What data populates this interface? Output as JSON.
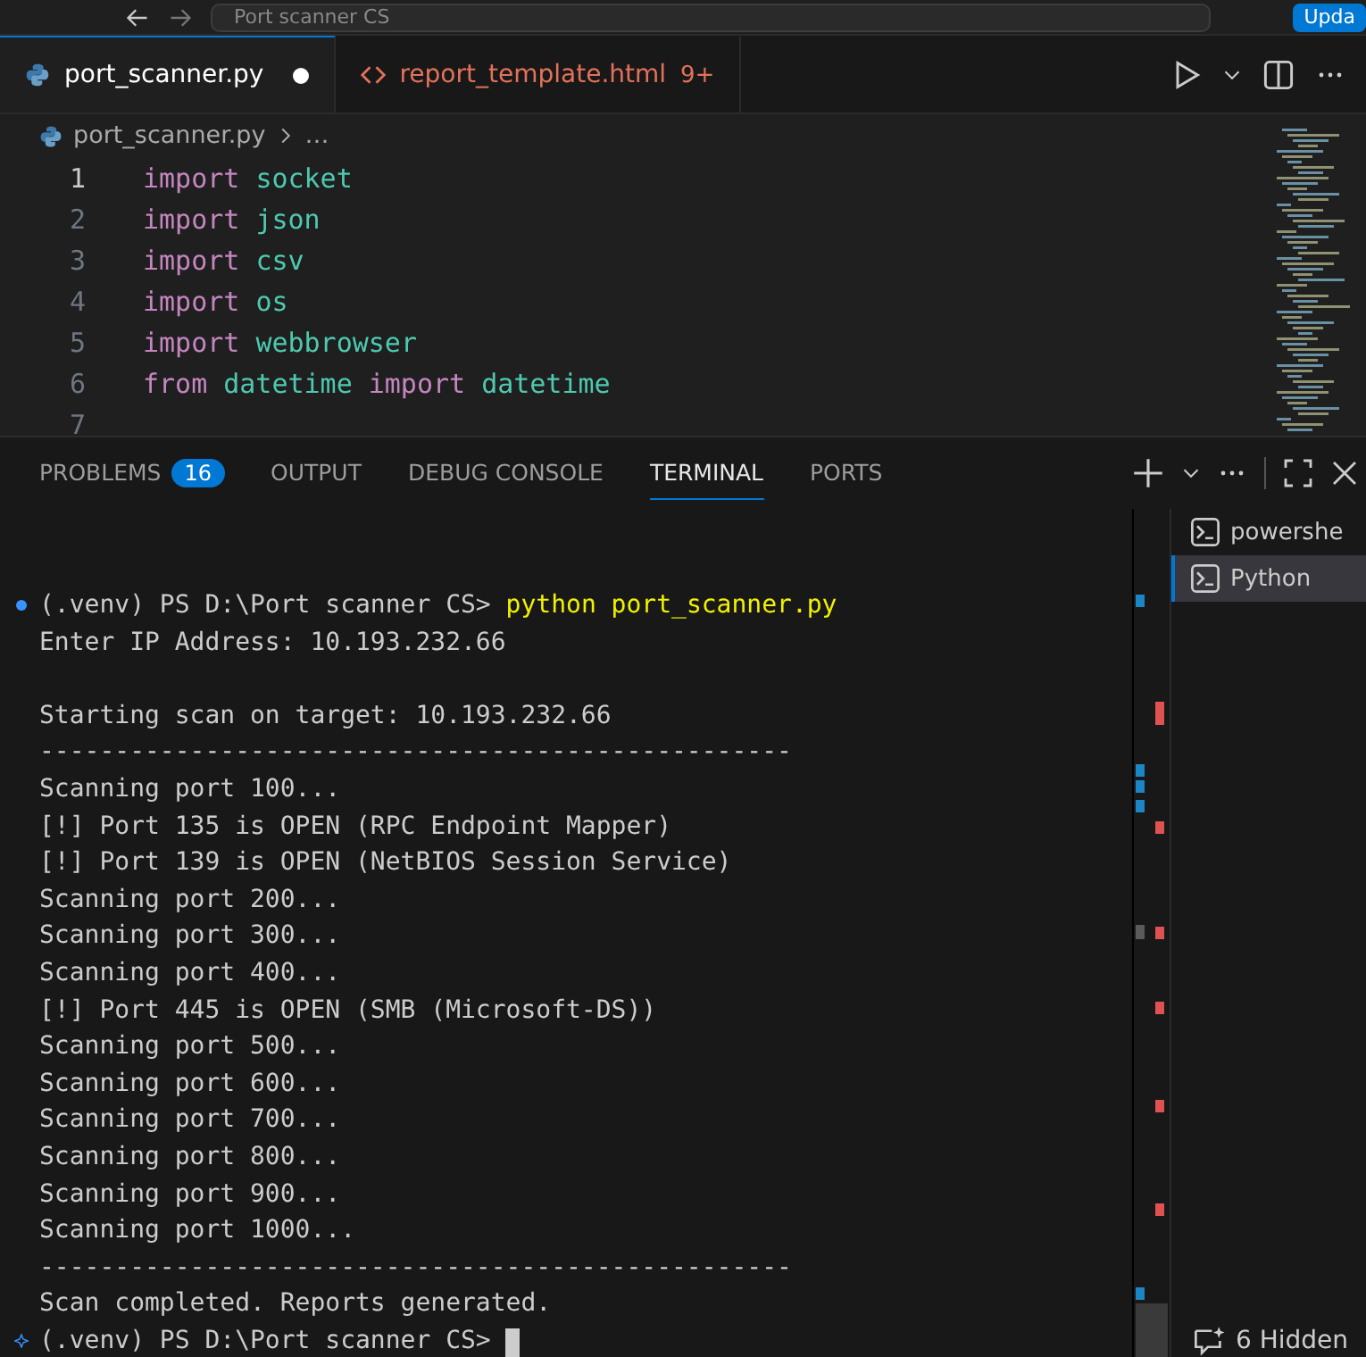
{
  "title_bar": {
    "search": "Port scanner CS",
    "update_button": "Upda"
  },
  "editor_tabs": [
    {
      "label": "port_scanner.py",
      "kind": "python",
      "selected": true,
      "modified": true
    },
    {
      "label": "report_template.html",
      "kind": "html",
      "selected": false,
      "modified": false,
      "problems": "9+"
    }
  ],
  "breadcrumb": {
    "file": "port_scanner.py",
    "more": "…"
  },
  "code_lines": [
    {
      "number": "1",
      "tokens": [
        {
          "text": "import",
          "kind": "keyword"
        },
        {
          "text": "socket",
          "kind": "module"
        }
      ]
    },
    {
      "number": "2",
      "tokens": [
        {
          "text": "import",
          "kind": "keyword"
        },
        {
          "text": "json",
          "kind": "module"
        }
      ]
    },
    {
      "number": "3",
      "tokens": [
        {
          "text": "import",
          "kind": "keyword"
        },
        {
          "text": "csv",
          "kind": "module"
        }
      ]
    },
    {
      "number": "4",
      "tokens": [
        {
          "text": "import",
          "kind": "keyword"
        },
        {
          "text": "os",
          "kind": "module"
        }
      ]
    },
    {
      "number": "5",
      "tokens": [
        {
          "text": "import",
          "kind": "keyword"
        },
        {
          "text": "webbrowser",
          "kind": "module"
        }
      ]
    },
    {
      "number": "6",
      "tokens": [
        {
          "text": "from",
          "kind": "keyword"
        },
        {
          "text": "datetime",
          "kind": "module"
        },
        {
          "text": "import",
          "kind": "keyword"
        },
        {
          "text": "datetime",
          "kind": "module"
        }
      ]
    },
    {
      "number": "7"
    }
  ],
  "panel_tabs": [
    {
      "label": "PROBLEMS",
      "badge": "16",
      "selected": false
    },
    {
      "label": "OUTPUT",
      "selected": false
    },
    {
      "label": "DEBUG CONSOLE",
      "selected": false
    },
    {
      "label": "TERMINAL",
      "selected": true
    },
    {
      "label": "PORTS",
      "selected": false
    }
  ],
  "terminal_lines": [
    {
      "kind": "prompt",
      "prompt": "(.venv) PS D:\\Port scanner CS>",
      "command": "python port_scanner.py"
    },
    {
      "kind": "output",
      "text": "Enter IP Address: 10.193.232.66"
    },
    {
      "kind": "blank"
    },
    {
      "kind": "output",
      "text": "Starting scan on target: 10.193.232.66"
    },
    {
      "kind": "output",
      "text": "--------------------------------------------------"
    },
    {
      "kind": "output",
      "text": "Scanning port 100..."
    },
    {
      "kind": "output",
      "text": "[!] Port 135 is OPEN (RPC Endpoint Mapper)"
    },
    {
      "kind": "output",
      "text": "[!] Port 139 is OPEN (NetBIOS Session Service)"
    },
    {
      "kind": "output",
      "text": "Scanning port 200..."
    },
    {
      "kind": "output",
      "text": "Scanning port 300..."
    },
    {
      "kind": "output",
      "text": "Scanning port 400..."
    },
    {
      "kind": "output",
      "text": "[!] Port 445 is OPEN (SMB (Microsoft-DS))"
    },
    {
      "kind": "output",
      "text": "Scanning port 500..."
    },
    {
      "kind": "output",
      "text": "Scanning port 600..."
    },
    {
      "kind": "output",
      "text": "Scanning port 700..."
    },
    {
      "kind": "output",
      "text": "Scanning port 800..."
    },
    {
      "kind": "output",
      "text": "Scanning port 900..."
    },
    {
      "kind": "output",
      "text": "Scanning port 1000..."
    },
    {
      "kind": "output",
      "text": "--------------------------------------------------"
    },
    {
      "kind": "output",
      "text": "Scan completed. Reports generated."
    },
    {
      "kind": "prompt",
      "prompt": "(.venv) PS D:\\Port scanner CS>",
      "cursor": true
    }
  ],
  "terminal_list": [
    {
      "label": "powershe",
      "selected": false
    },
    {
      "label": "Python",
      "selected": true
    }
  ],
  "hidden_terminals": "6 Hidden"
}
